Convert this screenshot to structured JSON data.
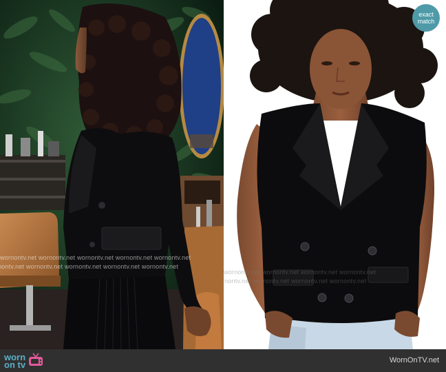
{
  "watermark": {
    "text": "wornontv.net"
  },
  "badge": {
    "line1": "exact",
    "line2": "match"
  },
  "footer": {
    "logo_line1": "worn",
    "logo_line2": "on tv",
    "site": "WornOnTV.net"
  },
  "colors": {
    "footer_bg": "#303030",
    "badge_bg": "#4f9aa8",
    "logo": "#5ab0c8"
  },
  "icons": [
    "tv-icon"
  ]
}
